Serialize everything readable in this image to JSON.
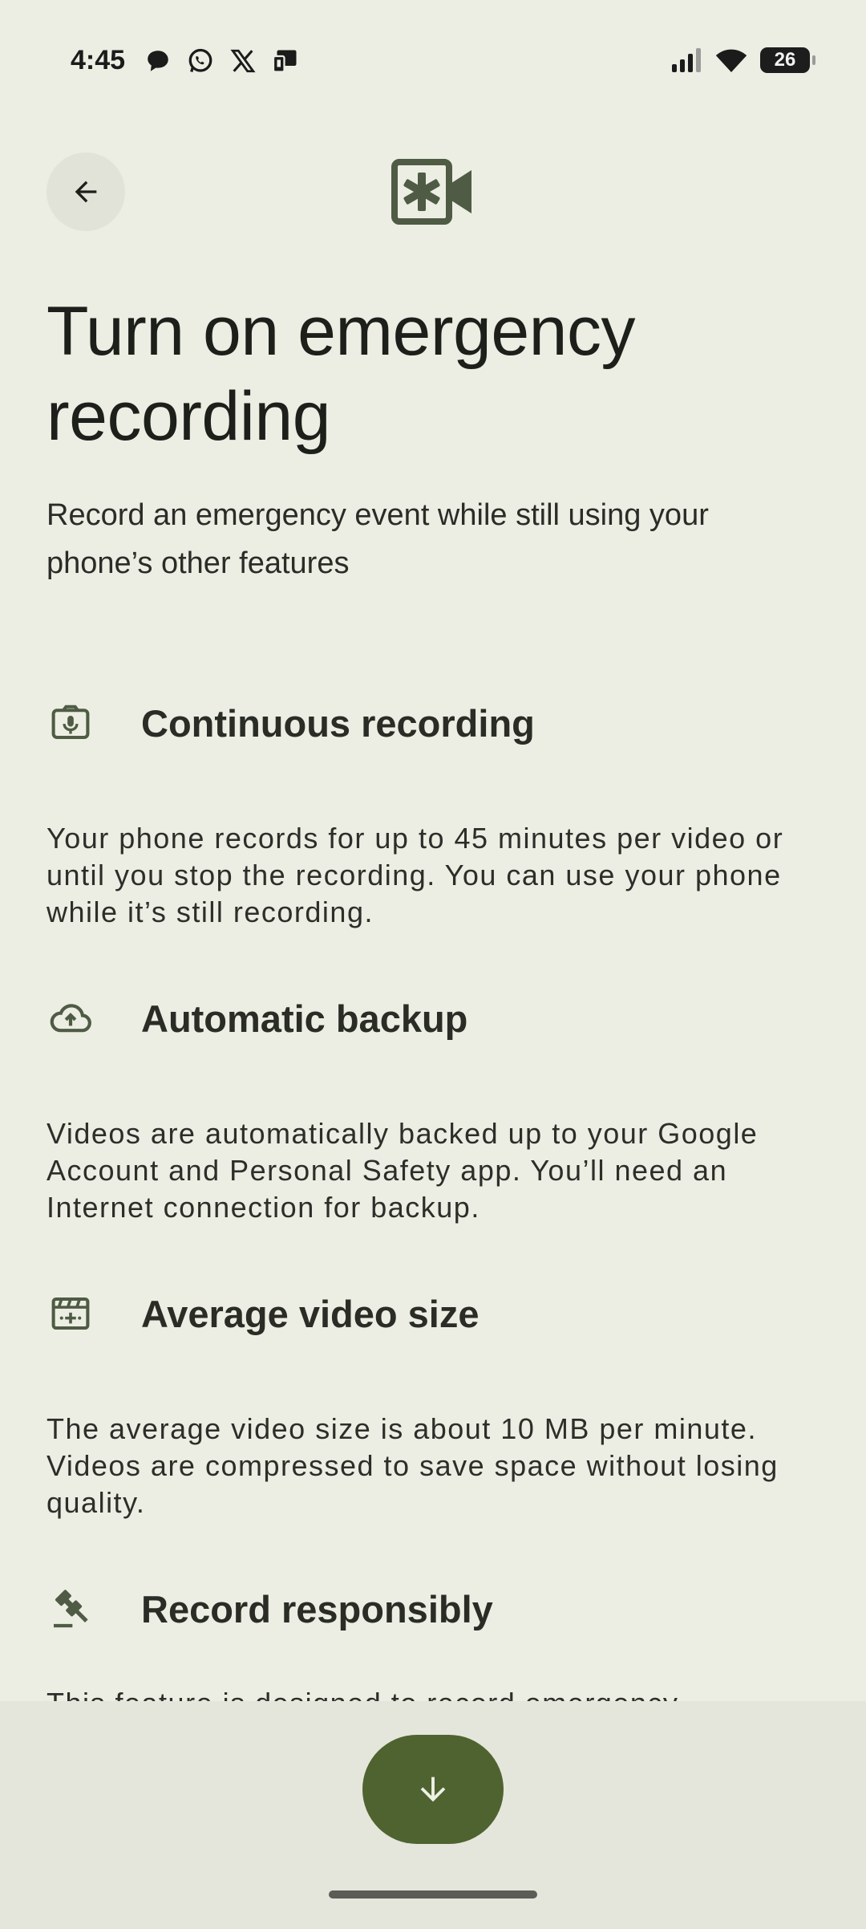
{
  "status_bar": {
    "time": "4:45",
    "app_icons": [
      "messages-icon",
      "whatsapp-icon",
      "x-icon",
      "cast-icon"
    ],
    "battery_level": "26",
    "signal_icon": "signal-icon",
    "wifi_icon": "wifi-icon"
  },
  "header": {
    "back_icon": "arrow-left-icon",
    "hero_icon": "emergency-video-icon"
  },
  "title": "Turn on emergency recording",
  "subtitle": "Record an emergency event while still using your phone’s other features",
  "features": [
    {
      "icon": "camera-mic-icon",
      "title": "Continuous recording",
      "description": "Your phone records for up to 45 minutes per video or until you stop the recording. You can use your phone while it’s still recording."
    },
    {
      "icon": "cloud-upload-icon",
      "title": "Automatic backup",
      "description": "Videos are automatically backed up to your Google Account and Personal Safety app. You’ll need an Internet connection for backup."
    },
    {
      "icon": "video-size-icon",
      "title": "Average video size",
      "description": "The average video size is about 10 MB per minute. Videos are compressed to save space without losing quality."
    },
    {
      "icon": "gavel-icon",
      "title": "Record responsibly",
      "description": "This feature is designed to record emergency"
    }
  ],
  "fab": {
    "icon": "arrow-down-icon"
  },
  "colors": {
    "background": "#eceee3",
    "accent": "#4f6330",
    "icon": "#4f5b44"
  }
}
